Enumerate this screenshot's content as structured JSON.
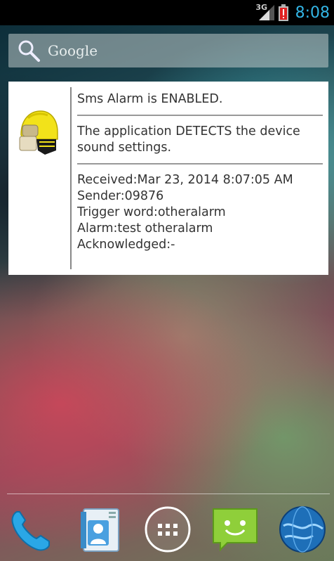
{
  "status_bar": {
    "network_type": "3G",
    "time": "8:08",
    "battery_icon": "battery-alert-icon",
    "signal_icon": "signal-icon"
  },
  "search": {
    "label": "Google",
    "icon": "search-icon"
  },
  "widget": {
    "icon": "firefighter-helmet-icon",
    "status_text": "Sms Alarm is ENABLED.",
    "sound_text": "The application DETECTS the device sound settings.",
    "received": "Received:Mar 23, 2014 8:07:05 AM",
    "sender": "Sender:09876",
    "trigger": "Trigger word:otheralarm",
    "alarm": "Alarm:test otheralarm",
    "acknowledged": "Acknowledged:-"
  },
  "dock": {
    "items": [
      {
        "name": "phone",
        "icon": "phone-icon"
      },
      {
        "name": "contacts",
        "icon": "contacts-icon"
      },
      {
        "name": "apps",
        "icon": "app-drawer-icon"
      },
      {
        "name": "messaging",
        "icon": "messaging-icon"
      },
      {
        "name": "browser",
        "icon": "globe-icon"
      }
    ]
  },
  "colors": {
    "clock": "#33b5e5",
    "battery_alert": "#e02020",
    "helmet": "#f2e21a"
  }
}
